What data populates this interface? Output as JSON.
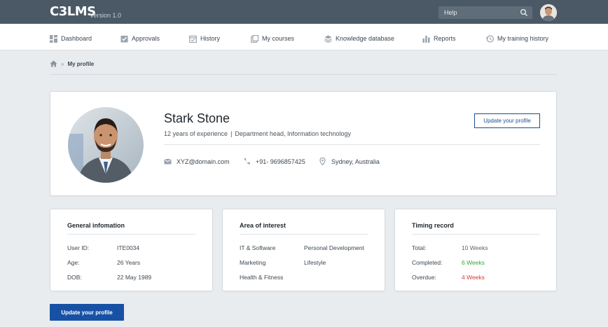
{
  "app": {
    "logo": "C3LMS",
    "version": "Version 1.0"
  },
  "search": {
    "placeholder": "Help"
  },
  "nav": {
    "items": [
      {
        "label": "Dashboard",
        "icon": "dashboard-icon"
      },
      {
        "label": "Approvals",
        "icon": "approvals-icon"
      },
      {
        "label": "History",
        "icon": "history-icon"
      },
      {
        "label": "My courses",
        "icon": "courses-icon"
      },
      {
        "label": "Knowledge database",
        "icon": "knowledge-icon"
      },
      {
        "label": "Reports",
        "icon": "reports-icon"
      },
      {
        "label": "My training history",
        "icon": "training-history-icon"
      }
    ]
  },
  "breadcrumb": {
    "current": "My profile",
    "separator": "»"
  },
  "profile": {
    "name": "Stark Stone",
    "experience": "12 years of experience",
    "separator": "|",
    "role": "Department head, Information technology",
    "email": "XYZ@domain.com",
    "phone": "+91- 9696857425",
    "location": "Sydney, Australia",
    "update_label": "Update your profile"
  },
  "general": {
    "title": "General infomation",
    "rows": [
      {
        "label": "User ID:",
        "value": "ITE0034"
      },
      {
        "label": "Age:",
        "value": "26 Years"
      },
      {
        "label": "DOB:",
        "value": "22 May 1989"
      }
    ]
  },
  "interest": {
    "title": "Area of interest",
    "col1": [
      "IT & Software",
      "Marketing",
      "Health & Fitness"
    ],
    "col2": [
      "Personal Development",
      "Lifestyle"
    ]
  },
  "timing": {
    "title": "Timing record",
    "rows": [
      {
        "label": "Total:",
        "value": "10 Weeks",
        "color": "#5c666e"
      },
      {
        "label": "Completed:",
        "value": "6 Weeks",
        "color": "#3aa53a"
      },
      {
        "label": "Overdue:",
        "value": "4 Weeks",
        "color": "#d23b3b"
      }
    ]
  },
  "footer": {
    "update_label": "Update your profile"
  },
  "colors": {
    "topbar": "#4a5965",
    "primary": "#1751a5",
    "accent": "#1c4f8e"
  }
}
